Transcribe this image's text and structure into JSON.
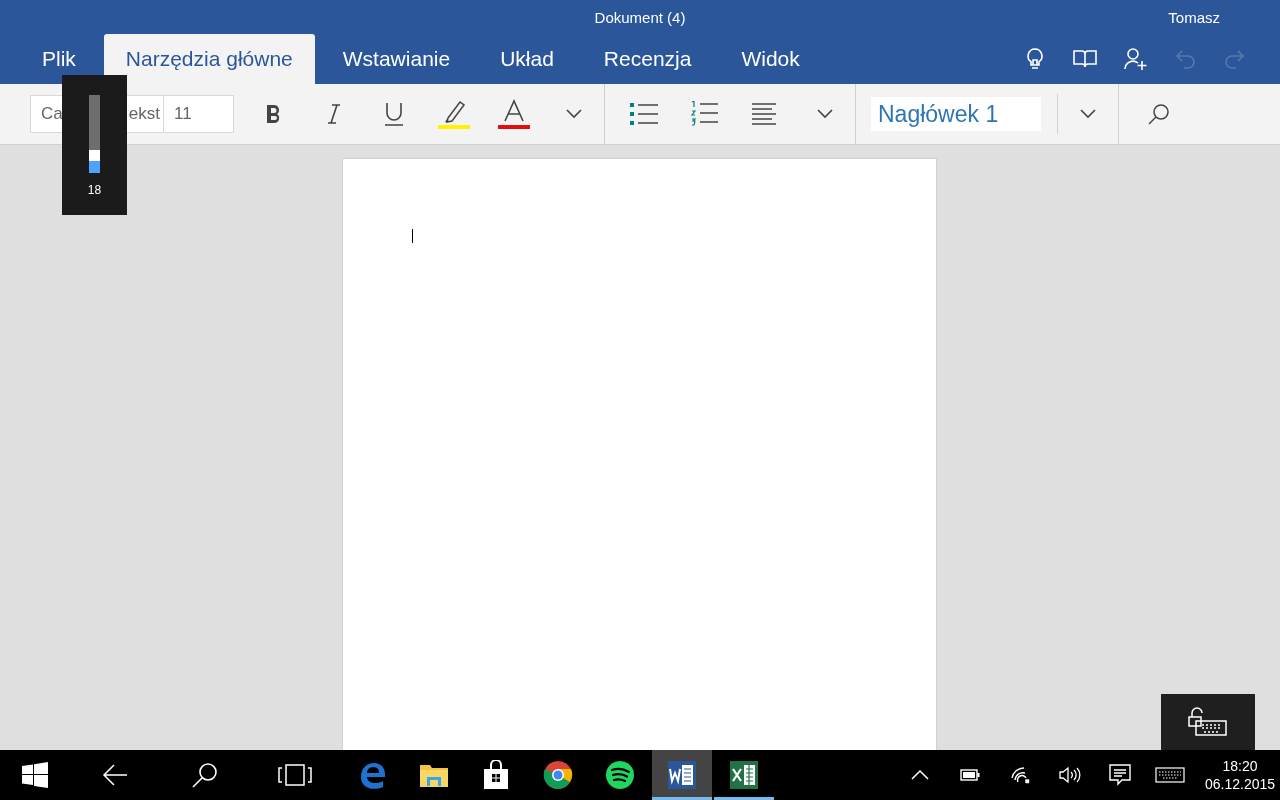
{
  "window": {
    "title": "Dokument (4)",
    "user": "Tomasz"
  },
  "tabs": [
    {
      "label": "Plik",
      "selected": false
    },
    {
      "label": "Narzędzia główne",
      "selected": true
    },
    {
      "label": "Wstawianie",
      "selected": false
    },
    {
      "label": "Układ",
      "selected": false
    },
    {
      "label": "Recenzja",
      "selected": false
    },
    {
      "label": "Widok",
      "selected": false
    }
  ],
  "header_actions": [
    {
      "kind": "lightbulb",
      "disabled": false
    },
    {
      "kind": "book",
      "disabled": false
    },
    {
      "kind": "share",
      "disabled": false
    },
    {
      "kind": "undo",
      "disabled": true
    },
    {
      "kind": "redo",
      "disabled": true
    }
  ],
  "ribbon": {
    "font": [
      "Ca",
      "ekst"
    ],
    "size": "11",
    "style": "Nagłówek 1"
  },
  "brightness": {
    "level": 0.15,
    "reading": "18"
  },
  "taskbar": {
    "apps": [
      {
        "kind": "edge",
        "running": false,
        "selected": false
      },
      {
        "kind": "explorer",
        "running": false,
        "selected": false
      },
      {
        "kind": "store",
        "running": false,
        "selected": false
      },
      {
        "kind": "chrome",
        "running": false,
        "selected": false
      },
      {
        "kind": "spotify",
        "running": false,
        "selected": false
      },
      {
        "kind": "word",
        "running": true,
        "selected": true
      },
      {
        "kind": "excel",
        "running": true,
        "selected": false
      }
    ],
    "time": "18:20",
    "date": "06.12.2015"
  }
}
